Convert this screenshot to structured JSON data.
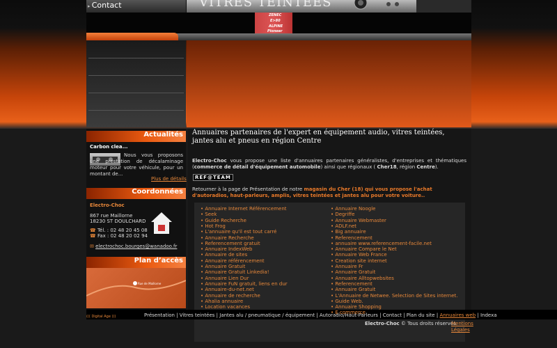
{
  "nav": {
    "contact": "Contact"
  },
  "banner": {
    "text": "VITRES TEINTEES",
    "radio_labels": [
      "ZENEC",
      "E>80",
      "ALPINE",
      "Pioneer"
    ]
  },
  "left": {
    "actualites": {
      "title": "Actualités",
      "item_title": "Carbon clea...",
      "item_text": "Nous vous proposons une prestation de décalaminage moteur pour votre véhicule, pour un montant de...",
      "more": "Plus de détails"
    },
    "coordonnees": {
      "title": "Coordonnées",
      "name": "Electro-Choc",
      "address1": "867 rue Maillorne",
      "address2": "18230 ST DOULCHARD",
      "tel": "Tél. : 02 48 20 45 08",
      "fax": "Fax : 02 48 20 02 94",
      "email": "electrochoc.bourges@wanadoo.fr"
    },
    "plan": {
      "title": "Plan d’accès",
      "map_label": "Rue de Maillorne"
    }
  },
  "main": {
    "heading": "Annuaires partenaires de l'expert en équipement audio, vitres teintées, jantes alu et pneus en région Centre",
    "intro_part1": "Electro-Choc",
    "intro_part2": " vous propose une liste d'annuaires partenaires généralistes, d'entreprises et thématiques (",
    "intro_bold1": "commerce de détail d'équipement automobile",
    "intro_part3": ") ainsi que régionaux ( ",
    "intro_bold2": "Cher18",
    "intro_part4": ", région ",
    "intro_bold3": "Centre",
    "intro_part5": ").",
    "ref_tag": "REF@TEAM",
    "return_text": "Retourner à la page de Présentation de notre ",
    "return_link": "magasin du Cher (18) qui vous propose l'achat d'autoradios, haut-parleurs, amplis, vitres teintées et jantes alu pour votre voiture..",
    "links_left": [
      "Annuaire Internet Référencement",
      "Seek",
      "Guide Recherche",
      "Hot Frog",
      "L'annuaire qu'il est tout carré",
      "Annuaire Recherche",
      "Referencement gratuit",
      "Annuaire IndexWeb",
      "Annuaire de sites",
      "Annuaire référencement",
      "Annuaire Gratuit",
      "Annuaire Gratuit Linkedia!",
      "Annuaire Lien Dur",
      "Annuaire FuN gratuit, liens en dur",
      "Annuaire-du-net.net",
      "Annuaire de recherche",
      "Ahalia annuaire",
      "Location vacances"
    ],
    "links_right": [
      "Annuaire Noogle",
      "Degriffe",
      "Annuaire Webmaster",
      "ADLF.net",
      "Big annuaire",
      "Referencement",
      "annuaire www.referencement-facile.net",
      "Annuaire Compare le Net",
      "Annuaire Web France",
      "Creation site internet",
      "Annuaire Fr",
      "Annuaire Gratuit",
      "Annuaire Alltopwebsites",
      "Referencement",
      "Annuaire Gratuit",
      "L'Annuaire de Netwee. Selection de Sites internet.",
      "Guide Web.",
      "Annuaire Shopping",
      "E commerce"
    ]
  },
  "footer": {
    "nav": [
      "Présentation",
      "Vitres teintées",
      "Jantes alu / pneumatique / équipement",
      "Autoradio/Haut-Parleurs",
      "Contact",
      "Plan du site",
      "Annuaires web",
      "Indexa"
    ],
    "digital": "((( Digital Age )))",
    "copyright_brand": "Electro-Choc",
    "copyright_text": " © Tous droits réservés. ",
    "legal": "Mentions Légales"
  }
}
